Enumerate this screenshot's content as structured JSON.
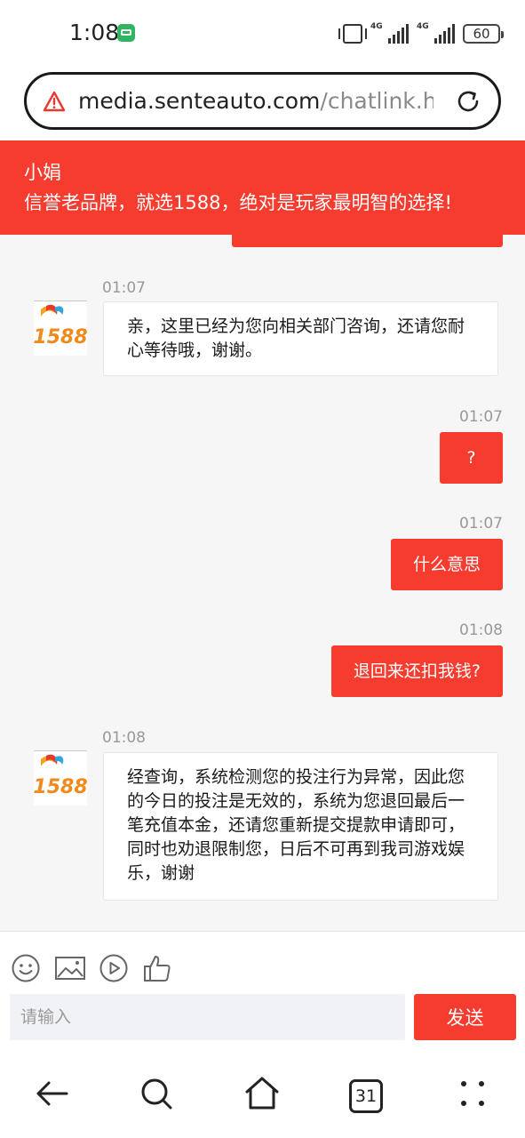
{
  "status_bar": {
    "time": "1:08",
    "app_icon": "green-shopping-bag-icon",
    "network_1": "4G",
    "network_2": "4G",
    "battery": "60"
  },
  "browser": {
    "security_icon": "warning-triangle-icon",
    "url_host": "media.senteauto.com",
    "url_path": "/chatlink.htm",
    "reload_icon": "reload-icon"
  },
  "header": {
    "agent_name": "小娟",
    "slogan": "信誉老品牌，就选1588，绝对是玩家最明智的选择!",
    "color": "#f53c2f"
  },
  "messages": [
    {
      "side": "in",
      "time": "01:07",
      "avatar_text": "1588",
      "text": "亲，这里已经为您向相关部门咨询，还请您耐心等待哦，谢谢。"
    },
    {
      "side": "out",
      "time": "01:07",
      "text": "?"
    },
    {
      "side": "out",
      "time": "01:07",
      "text": "什么意思"
    },
    {
      "side": "out",
      "time": "01:08",
      "text": "退回来还扣我钱?"
    },
    {
      "side": "in",
      "time": "01:08",
      "avatar_text": "1588",
      "text": "经查询，系统检测您的投注行为异常，因此您的今日的投注是无效的，系统为您退回最后一笔充值本金，还请您重新提交提款申请即可，同时也劝退限制您，日后不可再到我司游戏娱乐，谢谢"
    }
  ],
  "composer": {
    "icons": [
      "emoji-icon",
      "image-icon",
      "video-icon",
      "thumbs-up-icon"
    ],
    "placeholder": "请输入",
    "send_label": "发送"
  },
  "bottom_nav": {
    "tab_count": "31",
    "icons": [
      "back-arrow-icon",
      "search-icon",
      "home-icon",
      "tabs-icon",
      "more-icon"
    ]
  }
}
